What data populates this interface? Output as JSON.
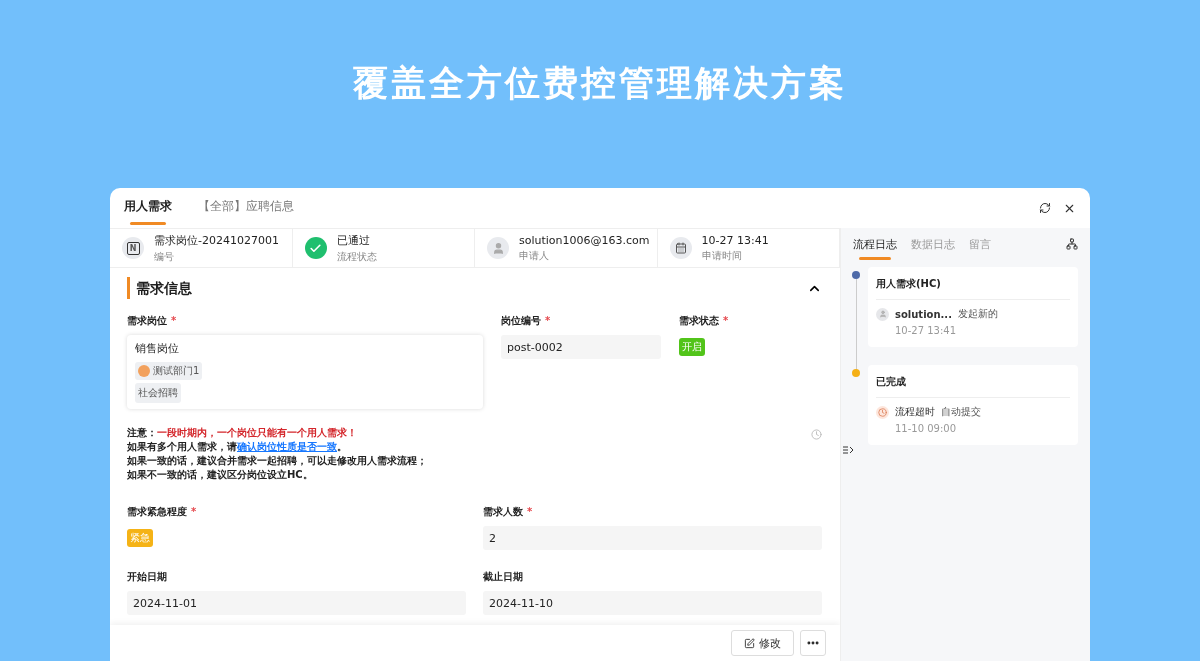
{
  "heading": "覆盖全方位费控管理解决方案",
  "tabs": [
    {
      "label": "用人需求",
      "selected": true
    },
    {
      "label": "【全部】应聘信息",
      "selected": false
    }
  ],
  "required_mark": "*",
  "summary": [
    {
      "kind": "code",
      "letter": "N",
      "value": "需求岗位-20241027001",
      "caption": "编号"
    },
    {
      "kind": "status",
      "value": "已通过",
      "caption": "流程状态"
    },
    {
      "kind": "user",
      "value": "solution1006@163.com",
      "caption": "申请人"
    },
    {
      "kind": "date",
      "value": "10-27 13:41",
      "caption": "申请时间"
    }
  ],
  "section": {
    "title": "需求信息",
    "expanded": true
  },
  "position": {
    "label": "需求岗位",
    "required": true,
    "value": "销售岗位",
    "tags": [
      {
        "kind": "dept",
        "text": "测试部门1"
      },
      {
        "kind": "plain",
        "text": "社会招聘"
      }
    ]
  },
  "post_code": {
    "label": "岗位编号",
    "required": true,
    "value": "post-0002"
  },
  "status": {
    "label": "需求状态",
    "required": true,
    "tag": "开启",
    "color": "#52c41a"
  },
  "notice": [
    [
      {
        "kind": "text",
        "text": "注意："
      },
      {
        "kind": "alert",
        "text": "一段时期内，一个岗位只能有一个用人需求！"
      }
    ],
    [
      {
        "kind": "text",
        "text": "如果有多个用人需求，请"
      },
      {
        "kind": "link",
        "text": "确认岗位性质是否一致"
      },
      {
        "kind": "text",
        "text": "。"
      }
    ],
    [
      {
        "kind": "text",
        "text": "如果一致的话，建议合并需求一起招聘，可以走修改用人需求流程；"
      }
    ],
    [
      {
        "kind": "text",
        "text": "如果不一致的话，建议区分岗位设立HC。"
      }
    ]
  ],
  "fields": [
    {
      "kind": "tag",
      "label": "需求紧急程度",
      "required": true,
      "value": "紧急",
      "color": "#f5b316"
    },
    {
      "kind": "input",
      "label": "需求人数",
      "required": true,
      "value": "2"
    },
    {
      "kind": "input",
      "label": "开始日期",
      "required": false,
      "value": "2024-11-01"
    },
    {
      "kind": "input",
      "label": "截止日期",
      "required": false,
      "value": "2024-11-10"
    }
  ],
  "footer": {
    "edit_label": "修改"
  },
  "log_tabs": [
    {
      "label": "流程日志",
      "selected": true
    },
    {
      "label": "数据日志",
      "selected": false
    },
    {
      "label": "留言",
      "selected": false
    }
  ],
  "timeline": [
    {
      "title": "用人需求(HC)",
      "color": "#4e6aa8",
      "kind": "user",
      "actor": "solution...",
      "action": "发起新的",
      "time": "10-27 13:41"
    },
    {
      "title": "已完成",
      "color": "#f5b016",
      "kind": "timeout",
      "actor": "流程超时",
      "action": "自动提交",
      "time": "11-10 09:00"
    }
  ]
}
